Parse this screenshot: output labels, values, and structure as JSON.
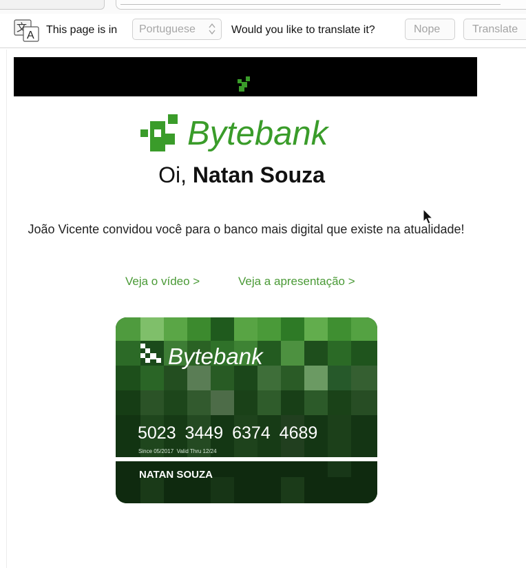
{
  "translate_bar": {
    "prefix": "This page is in",
    "language": "Portuguese",
    "question": "Would you like to translate it?",
    "nope_label": "Nope",
    "translate_label": "Translate",
    "icon": "translate-icon"
  },
  "email": {
    "brand": "Bytebank",
    "greeting_prefix": "Oi,",
    "greeting_name": "Natan Souza",
    "invite_text": "João Vicente convidou você para o banco mais digital que existe na atualidade!",
    "links": {
      "video": "Veja o vídeo >",
      "presentation": "Veja a apresentação >"
    },
    "card": {
      "brand": "Bytebank",
      "number": "5023 3449 6374 4689",
      "since": "Since 05/2017",
      "valid_thru": "Valid Thru 12/24",
      "holder": "NATAN SOUZA"
    }
  },
  "colors": {
    "brand_green": "#3a9c2a",
    "link_green": "#4a9a36",
    "banner_black": "#000000"
  }
}
